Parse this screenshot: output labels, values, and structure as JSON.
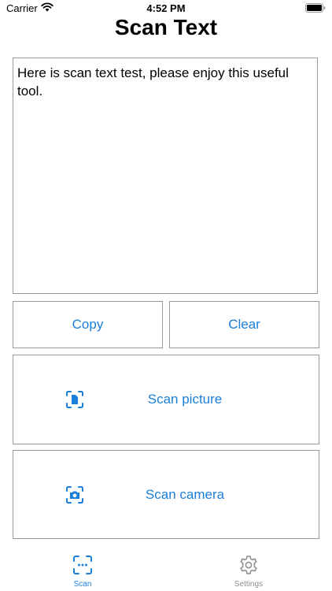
{
  "status_bar": {
    "carrier": "Carrier",
    "time": "4:52 PM"
  },
  "header": {
    "title": "Scan Text"
  },
  "text_area": {
    "value": "Here is scan text test, please enjoy this useful tool."
  },
  "buttons": {
    "copy_label": "Copy",
    "clear_label": "Clear",
    "scan_picture_label": "Scan picture",
    "scan_camera_label": "Scan camera"
  },
  "tab_bar": {
    "tabs": [
      {
        "label": "Scan",
        "icon": "scan-viewfinder-icon",
        "selected": true
      },
      {
        "label": "Settings",
        "icon": "gear-icon",
        "selected": false
      }
    ]
  },
  "colors": {
    "accent": "#1a7fd8",
    "inactive": "#8e8e93",
    "border": "#9a9a9a"
  }
}
